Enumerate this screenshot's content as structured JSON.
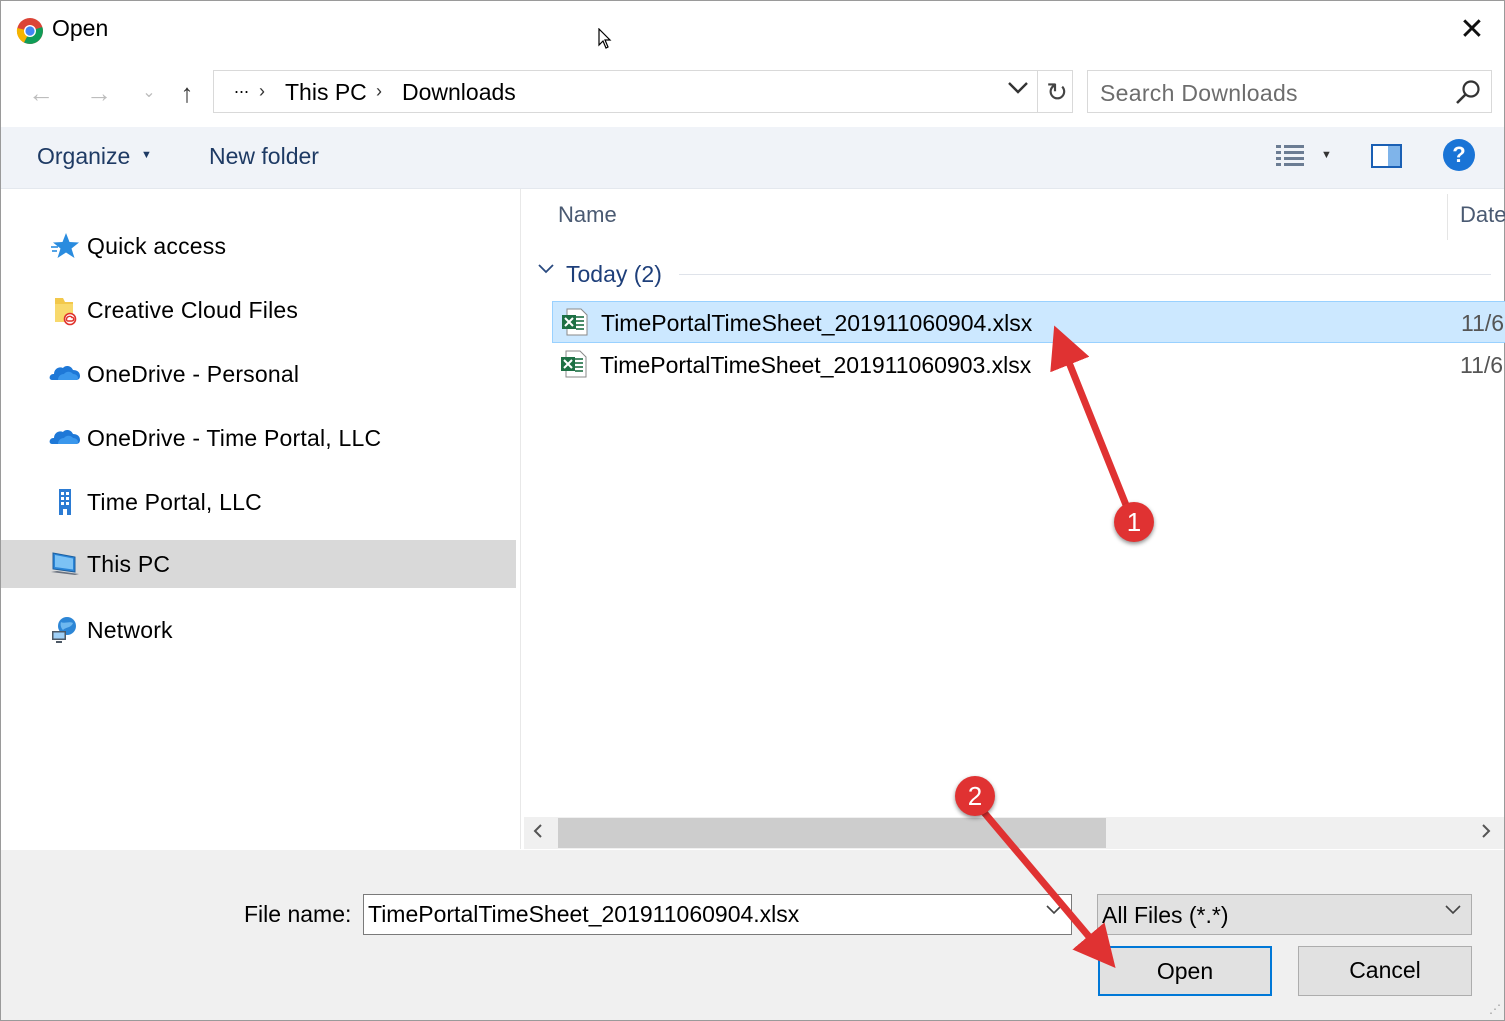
{
  "window": {
    "title": "Open",
    "close_glyph": "✕",
    "app_icon": "chrome-icon"
  },
  "nav": {
    "back_glyph": "←",
    "forward_glyph": "→",
    "recent_glyph": "⌄",
    "up_glyph": "↑",
    "refresh_glyph": "↻",
    "breadcrumb": {
      "ellipsis": "...",
      "items": [
        "This PC",
        "Downloads"
      ],
      "separator": "›"
    },
    "search_placeholder": "Search Downloads"
  },
  "toolbar": {
    "organize_label": "Organize",
    "new_folder_label": "New folder",
    "help_glyph": "?"
  },
  "sidebar": {
    "items": [
      {
        "label": "Quick access",
        "icon": "star-icon"
      },
      {
        "label": "Creative Cloud Files",
        "icon": "creative-cloud-folder-icon"
      },
      {
        "label": "OneDrive - Personal",
        "icon": "onedrive-icon"
      },
      {
        "label": "OneDrive - Time Portal, LLC",
        "icon": "onedrive-icon"
      },
      {
        "label": "Time Portal, LLC",
        "icon": "building-icon"
      },
      {
        "label": "This PC",
        "icon": "computer-icon",
        "selected": true
      },
      {
        "label": "Network",
        "icon": "network-icon"
      }
    ]
  },
  "filelist": {
    "columns": {
      "name": "Name",
      "date": "Date"
    },
    "group": {
      "label": "Today",
      "count": "(2)"
    },
    "files": [
      {
        "name": "TimePortalTimeSheet_201911060904.xlsx",
        "date": "11/6",
        "selected": true,
        "icon": "excel-file-icon"
      },
      {
        "name": "TimePortalTimeSheet_201911060903.xlsx",
        "date": "11/6",
        "selected": false,
        "icon": "excel-file-icon"
      }
    ]
  },
  "footer": {
    "file_name_label": "File name:",
    "file_name_value": "TimePortalTimeSheet_201911060904.xlsx",
    "filter_value": "All Files (*.*)",
    "open_label": "Open",
    "cancel_label": "Cancel"
  },
  "annotations": {
    "step1": "1",
    "step2": "2",
    "color": "#e03232"
  },
  "colors": {
    "selection_bg": "#cce8ff",
    "accent": "#0078d7",
    "toolbar_text": "#1e3a64"
  }
}
